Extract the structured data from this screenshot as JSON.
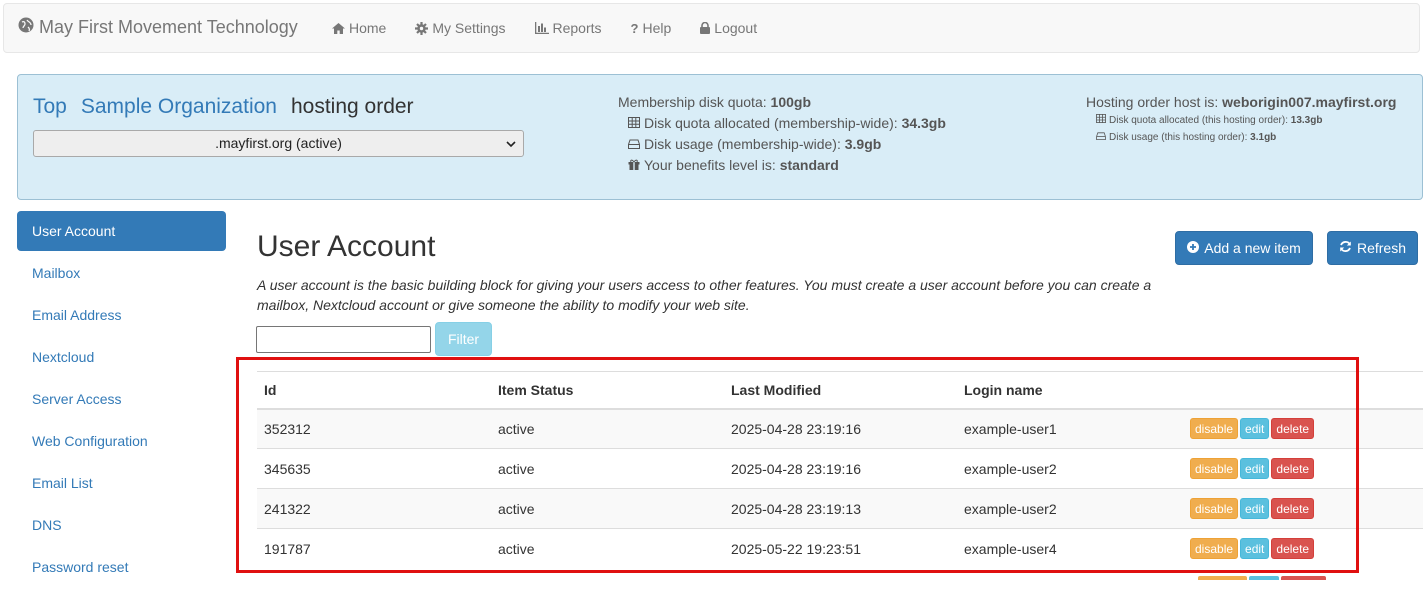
{
  "navbar": {
    "brand": "May First Movement Technology",
    "items": [
      {
        "label": "Home",
        "icon": "home-icon"
      },
      {
        "label": "My Settings",
        "icon": "gear-icon"
      },
      {
        "label": "Reports",
        "icon": "bar-chart-icon"
      },
      {
        "label": "Help",
        "icon": "question-icon"
      },
      {
        "label": "Logout",
        "icon": "lock-icon"
      }
    ]
  },
  "info": {
    "breadcrumb_top": "Top",
    "breadcrumb_org": "Sample Organization",
    "breadcrumb_suffix": "hosting order",
    "select_value": ".mayfirst.org (active)",
    "quota_label": "Membership disk quota: ",
    "quota_value": "100gb",
    "allocated_label": "Disk quota allocated (membership-wide): ",
    "allocated_value": "34.3gb",
    "usage_label": "Disk usage (membership-wide): ",
    "usage_value": "3.9gb",
    "benefits_label": "Your benefits level is: ",
    "benefits_value": "standard",
    "host_label": "Hosting order host is: ",
    "host_value": "weborigin007.mayfirst.org",
    "host_allocated_label": "Disk quota allocated (this hosting order): ",
    "host_allocated_value": "13.3gb",
    "host_usage_label": "Disk usage (this hosting order): ",
    "host_usage_value": "3.1gb"
  },
  "sidebar": {
    "items": [
      {
        "label": "User Account",
        "active": true
      },
      {
        "label": "Mailbox"
      },
      {
        "label": "Email Address"
      },
      {
        "label": "Nextcloud"
      },
      {
        "label": "Server Access"
      },
      {
        "label": "Web Configuration"
      },
      {
        "label": "Email List"
      },
      {
        "label": "DNS"
      },
      {
        "label": "Password reset"
      }
    ]
  },
  "main": {
    "title": "User Account",
    "description": "A user account is the basic building block for giving your users access to other features. You must create a user account before you can create a mailbox, Nextcloud account or give someone the ability to modify your web site.",
    "add_button": "Add a new item",
    "refresh_button": "Refresh",
    "filter_placeholder": "",
    "filter_button": "Filter"
  },
  "table": {
    "headers": [
      "Id",
      "Item Status",
      "Last Modified",
      "Login name"
    ],
    "actions": {
      "disable": "disable",
      "edit": "edit",
      "delete": "delete"
    },
    "rows": [
      {
        "id": "352312",
        "status": "active",
        "modified": "2025-04-28 23:19:16",
        "login": "example-user1"
      },
      {
        "id": "345635",
        "status": "active",
        "modified": "2025-04-28 23:19:16",
        "login": "example-user2"
      },
      {
        "id": "241322",
        "status": "active",
        "modified": "2025-04-28 23:19:13",
        "login": "example-user2"
      },
      {
        "id": "191787",
        "status": "active",
        "modified": "2025-05-22 19:23:51",
        "login": "example-user4"
      }
    ]
  },
  "colors": {
    "primary": "#337ab7",
    "info": "#5bc0de",
    "warning": "#f0ad4e",
    "danger": "#d9534f",
    "panel_bg": "#d9edf7",
    "highlight": "#e01010"
  }
}
